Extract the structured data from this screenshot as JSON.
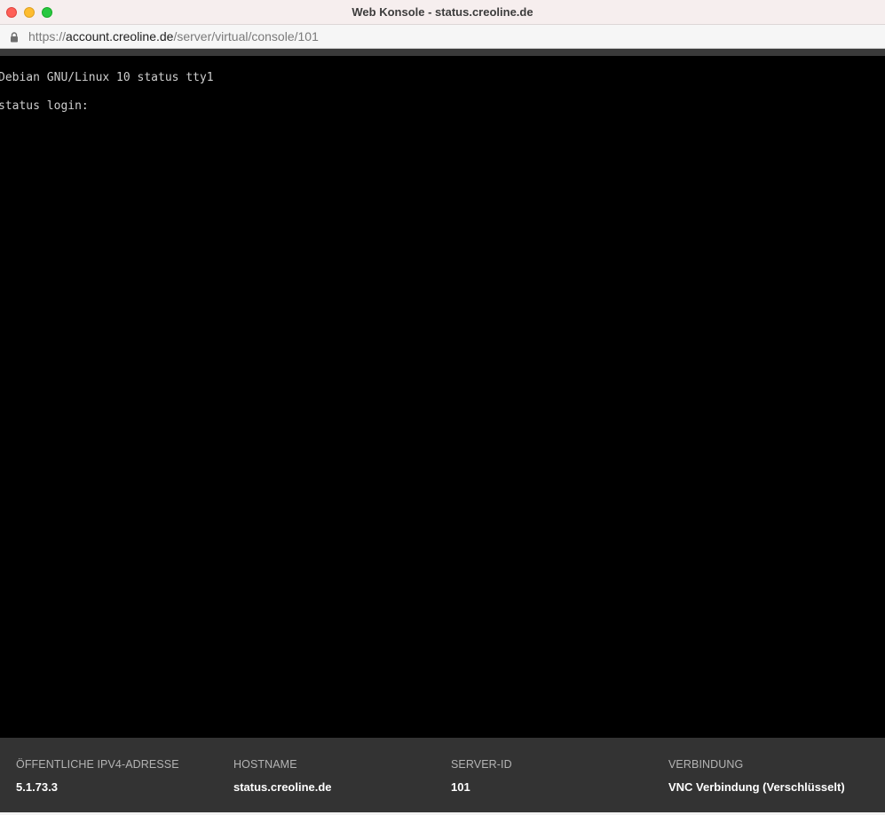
{
  "window": {
    "title": "Web Konsole - status.creoline.de"
  },
  "urlbar": {
    "icon": "lock-icon",
    "scheme": "https://",
    "host": "account.creoline.de",
    "path": "/server/virtual/console/101"
  },
  "console": {
    "lines": [
      "Debian GNU/Linux 10 status tty1",
      "status login:"
    ]
  },
  "info": {
    "ipv4": {
      "label": "ÖFFENTLICHE IPV4-ADRESSE",
      "value": "5.1.73.3"
    },
    "hostname": {
      "label": "HOSTNAME",
      "value": "status.creoline.de"
    },
    "server_id": {
      "label": "SERVER-ID",
      "value": "101"
    },
    "connection": {
      "label": "VERBINDUNG",
      "value": "VNC Verbindung (Verschlüsselt)"
    }
  },
  "colors": {
    "close": "#ff5f57",
    "minimize": "#febc2e",
    "maximize": "#28c840",
    "infobar_bg": "#333333"
  }
}
